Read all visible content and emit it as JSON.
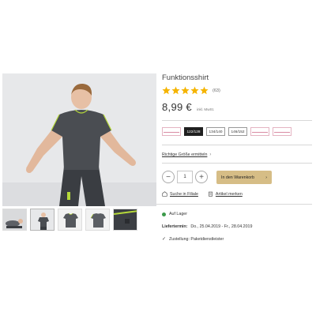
{
  "product": {
    "title": "Funktionsshirt",
    "rating_count": "(63)",
    "price": "8,99 €",
    "vat_note": "inkl. MwSt."
  },
  "thumbnails": [
    {
      "icon": "kids-on-floor-thumbnail"
    },
    {
      "icon": "boy-in-shirt-thumbnail"
    },
    {
      "icon": "shirt-front-thumbnail"
    },
    {
      "icon": "shirt-back-thumbnail"
    },
    {
      "icon": "fabric-detail-thumbnail"
    }
  ],
  "sizes": {
    "options": [
      "",
      "122/128",
      "134/140",
      "146/152",
      "",
      ""
    ],
    "selected": "122/128"
  },
  "size_link": "Richtige Größe ermitteln",
  "quantity": "1",
  "cart_button": "In den Warenkorb",
  "store_search": "Suche in Filiale",
  "remember": "Artikel merken",
  "availability": "Auf Lager",
  "delivery": {
    "label": "Liefertermin:",
    "value": "Do., 25.04.2019 - Fr., 28.04.2019"
  },
  "shipping": "Zustellung: Paketdienstleister",
  "colors": {
    "accent_gold": "#d6bd86",
    "stock_green": "#3c9a4a",
    "star_gold": "#f5b400",
    "disabled_pink": "#d98aa3"
  }
}
